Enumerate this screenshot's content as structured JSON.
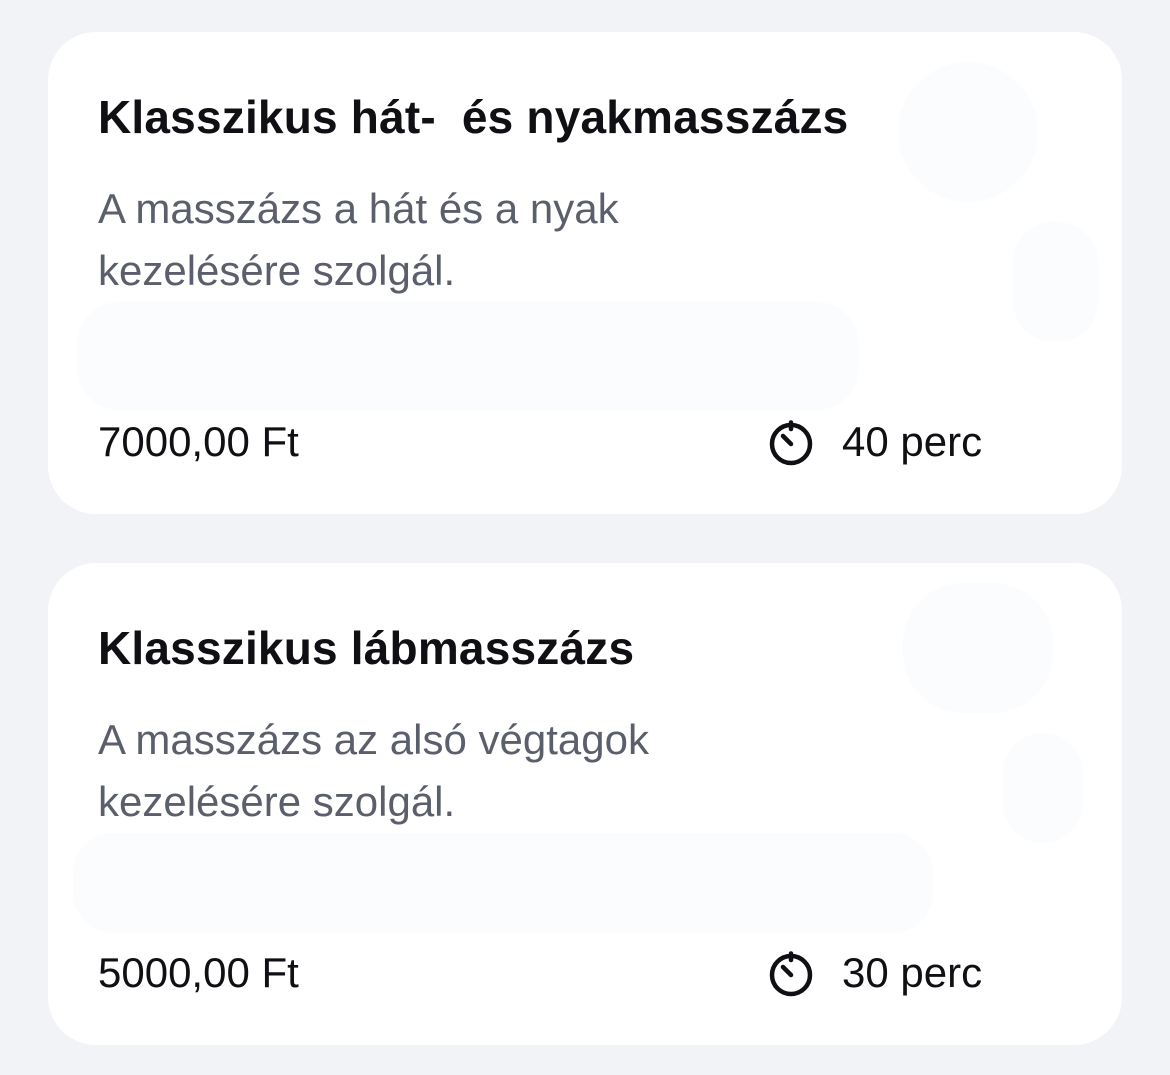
{
  "services": [
    {
      "title": "Klasszikus hát-  és nyakmasszázs",
      "description": "A masszázs a hát és a nyak kezelésére szolgál.",
      "price": "7000,00 Ft",
      "duration": "40 perc",
      "duration_icon": "timer-icon"
    },
    {
      "title": "Klasszikus lábmasszázs",
      "description": "A masszázs az alsó végtagok kezelésére szolgál.",
      "price": "5000,00 Ft",
      "duration": "30 perc",
      "duration_icon": "timer-icon"
    }
  ],
  "colors": {
    "background": "#f2f3f7",
    "card": "#ffffff",
    "title": "#0f0f14",
    "description": "#5b5f6b"
  }
}
